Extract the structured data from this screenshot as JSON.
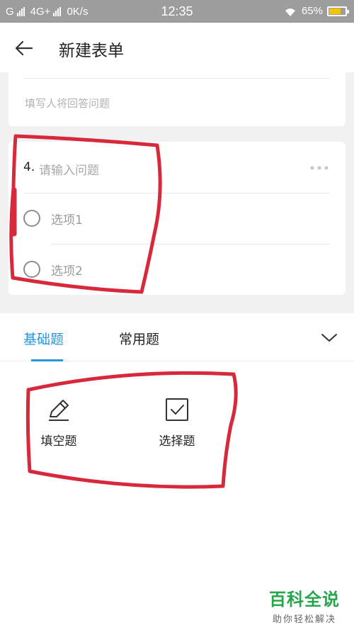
{
  "status_bar": {
    "carrier1": "G",
    "carrier2": "4G+",
    "speed": "0K/s",
    "time": "12:35",
    "battery": "65%",
    "battery_level": 0.65,
    "battery_color": "#f5c400"
  },
  "header": {
    "back_icon": "arrow-left-icon",
    "title": "新建表单"
  },
  "form": {
    "prev_question_placeholder": "填写人将回答问题",
    "question": {
      "number": "4.",
      "placeholder": "请输入问题",
      "options": [
        "选项1",
        "选项2"
      ]
    }
  },
  "panel": {
    "tabs": [
      {
        "label": "基础题",
        "active": true
      },
      {
        "label": "常用题",
        "active": false
      }
    ],
    "collapse_icon": "chevron-down-icon",
    "question_types": [
      {
        "label": "填空题",
        "icon": "pencil-icon"
      },
      {
        "label": "选择题",
        "icon": "checkbox-icon"
      }
    ]
  },
  "watermark": {
    "title": "百科全说",
    "subtitle": "助你轻松解决"
  },
  "colors": {
    "accent": "#2b95d8",
    "annotation": "#d8283b",
    "watermark": "#27a54a"
  }
}
